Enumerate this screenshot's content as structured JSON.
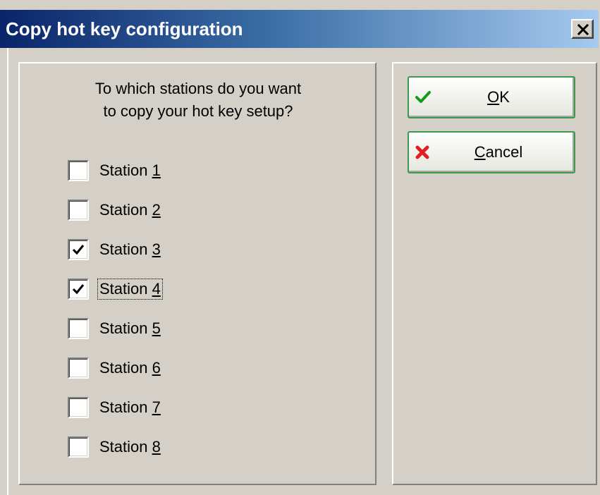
{
  "window": {
    "title": "Copy hot key configuration",
    "close_symbol": "×"
  },
  "prompt": {
    "line1": "To which stations do you want",
    "line2": "to copy your hot key setup?"
  },
  "stations": [
    {
      "prefix": "Station ",
      "accel": "1",
      "checked": false,
      "focused": false
    },
    {
      "prefix": "Station ",
      "accel": "2",
      "checked": false,
      "focused": false
    },
    {
      "prefix": "Station ",
      "accel": "3",
      "checked": true,
      "focused": false
    },
    {
      "prefix": "Station ",
      "accel": "4",
      "checked": true,
      "focused": true
    },
    {
      "prefix": "Station ",
      "accel": "5",
      "checked": false,
      "focused": false
    },
    {
      "prefix": "Station ",
      "accel": "6",
      "checked": false,
      "focused": false
    },
    {
      "prefix": "Station ",
      "accel": "7",
      "checked": false,
      "focused": false
    },
    {
      "prefix": "Station ",
      "accel": "8",
      "checked": false,
      "focused": false
    }
  ],
  "buttons": {
    "ok": {
      "accel": "O",
      "rest": "K",
      "icon": "checkmark-icon",
      "icon_color": "#1a9a1a"
    },
    "cancel": {
      "accel": "C",
      "rest": "ancel",
      "icon": "x-icon",
      "icon_color": "#e02020"
    }
  },
  "colors": {
    "title_gradient_start": "#0a246a",
    "title_gradient_end": "#a6caf0",
    "button_border": "#3c9a50",
    "dialog_bg": "#d4d0c8"
  }
}
